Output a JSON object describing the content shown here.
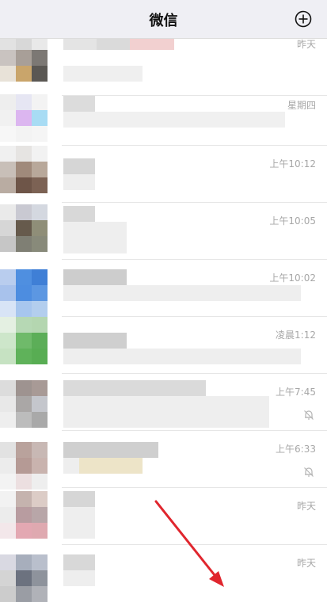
{
  "header": {
    "title": "微信"
  },
  "chats": [
    {
      "time": "昨天",
      "muted": false
    },
    {
      "time": "星期四",
      "muted": false
    },
    {
      "time": "上午10:12",
      "muted": false
    },
    {
      "time": "上午10:05",
      "muted": false
    },
    {
      "time": "上午10:02",
      "muted": false
    },
    {
      "time": "凌晨1:12",
      "muted": false
    },
    {
      "time": "上午7:45",
      "muted": true
    },
    {
      "time": "上午6:33",
      "muted": true
    },
    {
      "time": "昨天",
      "muted": false
    },
    {
      "time": "昨天",
      "muted": false
    }
  ],
  "colors": {
    "annotation_arrow": "#e0262e",
    "header_bg": "#efeff4"
  }
}
